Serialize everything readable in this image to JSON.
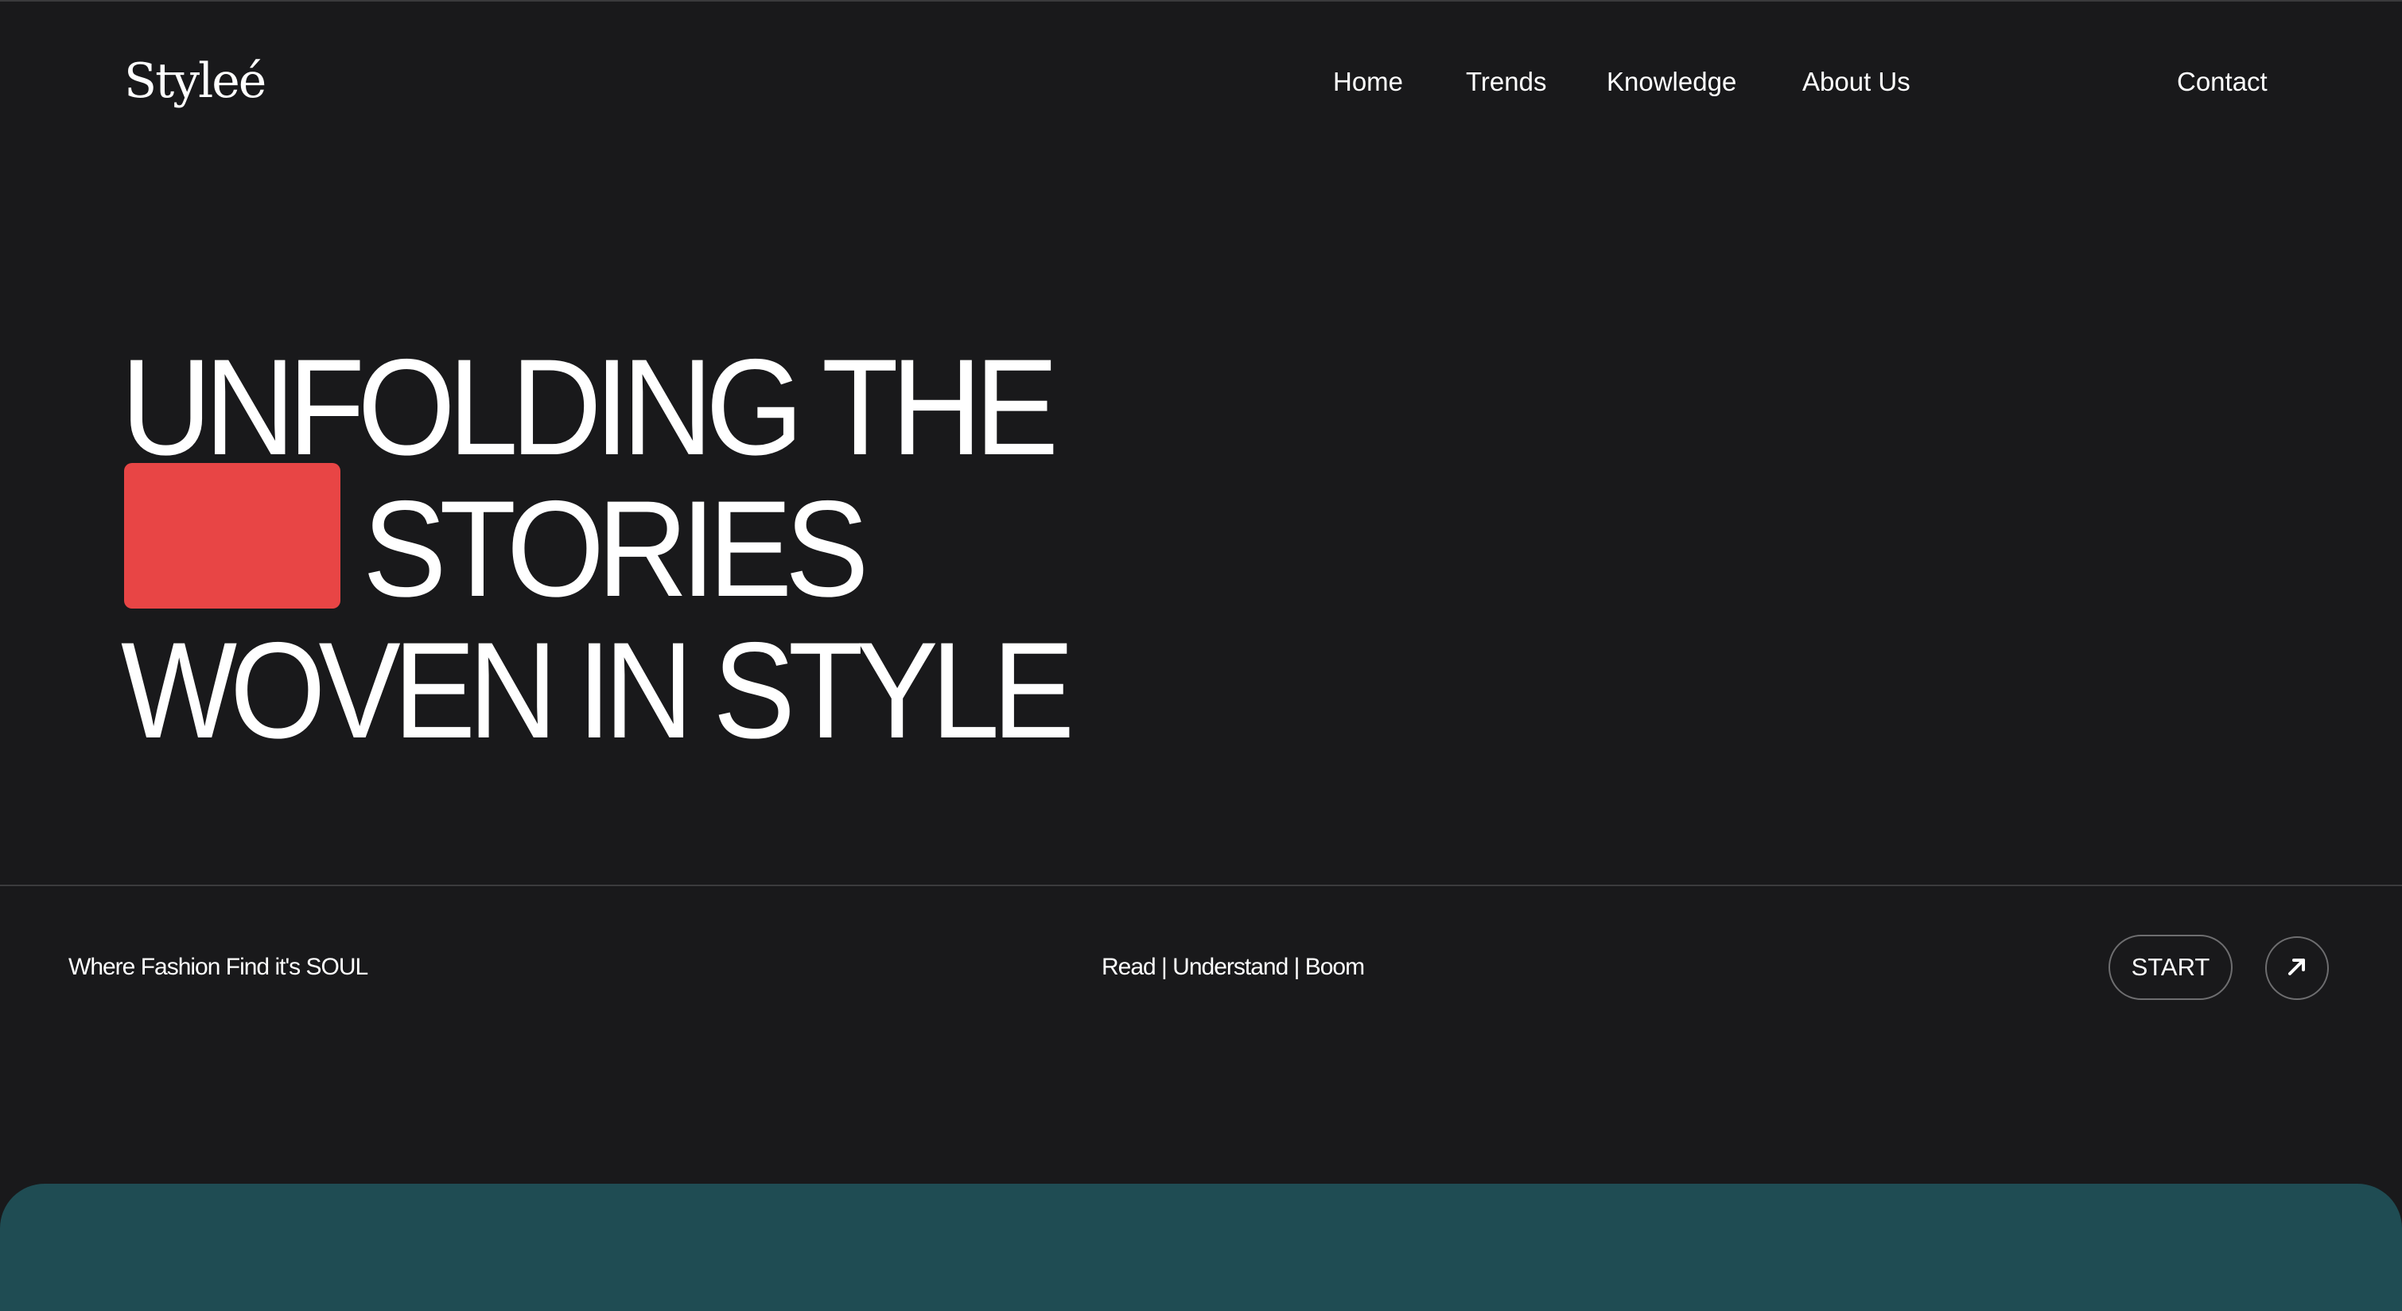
{
  "header": {
    "logo_text": "Styleé",
    "nav": [
      {
        "label": "Home"
      },
      {
        "label": "Trends"
      },
      {
        "label": "Knowledge"
      },
      {
        "label": "About Us"
      }
    ],
    "contact_label": "Contact"
  },
  "hero": {
    "line1": "UNFOLDING THE",
    "line2": "STORIES",
    "line3": "WOVEN IN STYLE",
    "accent_color": "#e84545"
  },
  "footer_bar": {
    "tagline": "Where Fashion Find it's SOUL",
    "center_text": "Read | Understand | Boom",
    "start_label": "START",
    "arrow_icon": "arrow-up-right-icon"
  },
  "colors": {
    "background": "#19191b",
    "teal_panel": "#1f4c53",
    "text": "#ffffff"
  }
}
